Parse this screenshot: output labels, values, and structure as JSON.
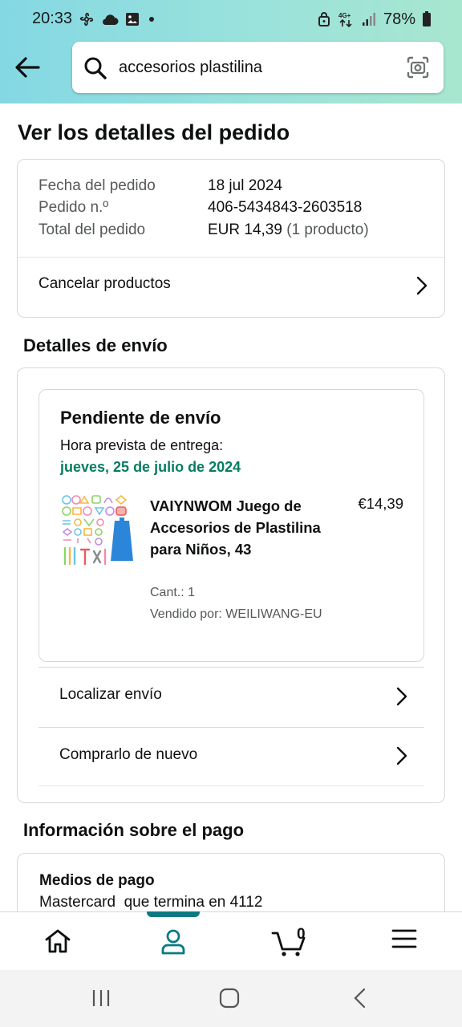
{
  "status_bar": {
    "time": "20:33",
    "battery": "78%",
    "network": "4G+",
    "icons": [
      "fan-icon",
      "cloud-icon",
      "image-icon",
      "dot-icon",
      "lock-icon",
      "signal-icon",
      "battery-icon"
    ]
  },
  "search": {
    "query": "accesorios plastilina"
  },
  "page": {
    "title": "Ver los detalles del pedido"
  },
  "order_summary": {
    "rows": [
      {
        "label": "Fecha del pedido",
        "value": "18 jul 2024"
      },
      {
        "label": "Pedido n.º",
        "value": "406-5434843-2603518"
      },
      {
        "label": "Total del pedido",
        "value": "EUR 14,39",
        "extra": "(1 producto)"
      }
    ],
    "cancel_label": "Cancelar productos"
  },
  "shipping": {
    "section_title": "Detalles de envío",
    "status": "Pendiente de envío",
    "eta_label": "Hora prevista de entrega:",
    "eta_date": "jueves, 25 de julio de 2024",
    "product": {
      "title": "VAIYNWOM Juego de Accesorios de Plastilina para Niños, 43",
      "price": "€14,39",
      "quantity": "Cant.: 1",
      "seller": "Vendido por: WEILIWANG-EU"
    },
    "track_label": "Localizar envío",
    "buy_again_label": "Comprarlo de nuevo"
  },
  "payment": {
    "section_title": "Información sobre el pago",
    "title": "Medios de pago",
    "method": "Mastercard  que termina en 4112"
  },
  "bottom_nav": {
    "items": [
      "home-icon",
      "account-icon",
      "cart-icon",
      "menu-icon"
    ],
    "active": "account-icon",
    "cart_count": "0",
    "accent_color": "#0b7a83"
  },
  "colors": {
    "eta_green": "#067d62",
    "header_gradient_start": "#84d8e3",
    "header_gradient_end": "#a8e6cf"
  }
}
